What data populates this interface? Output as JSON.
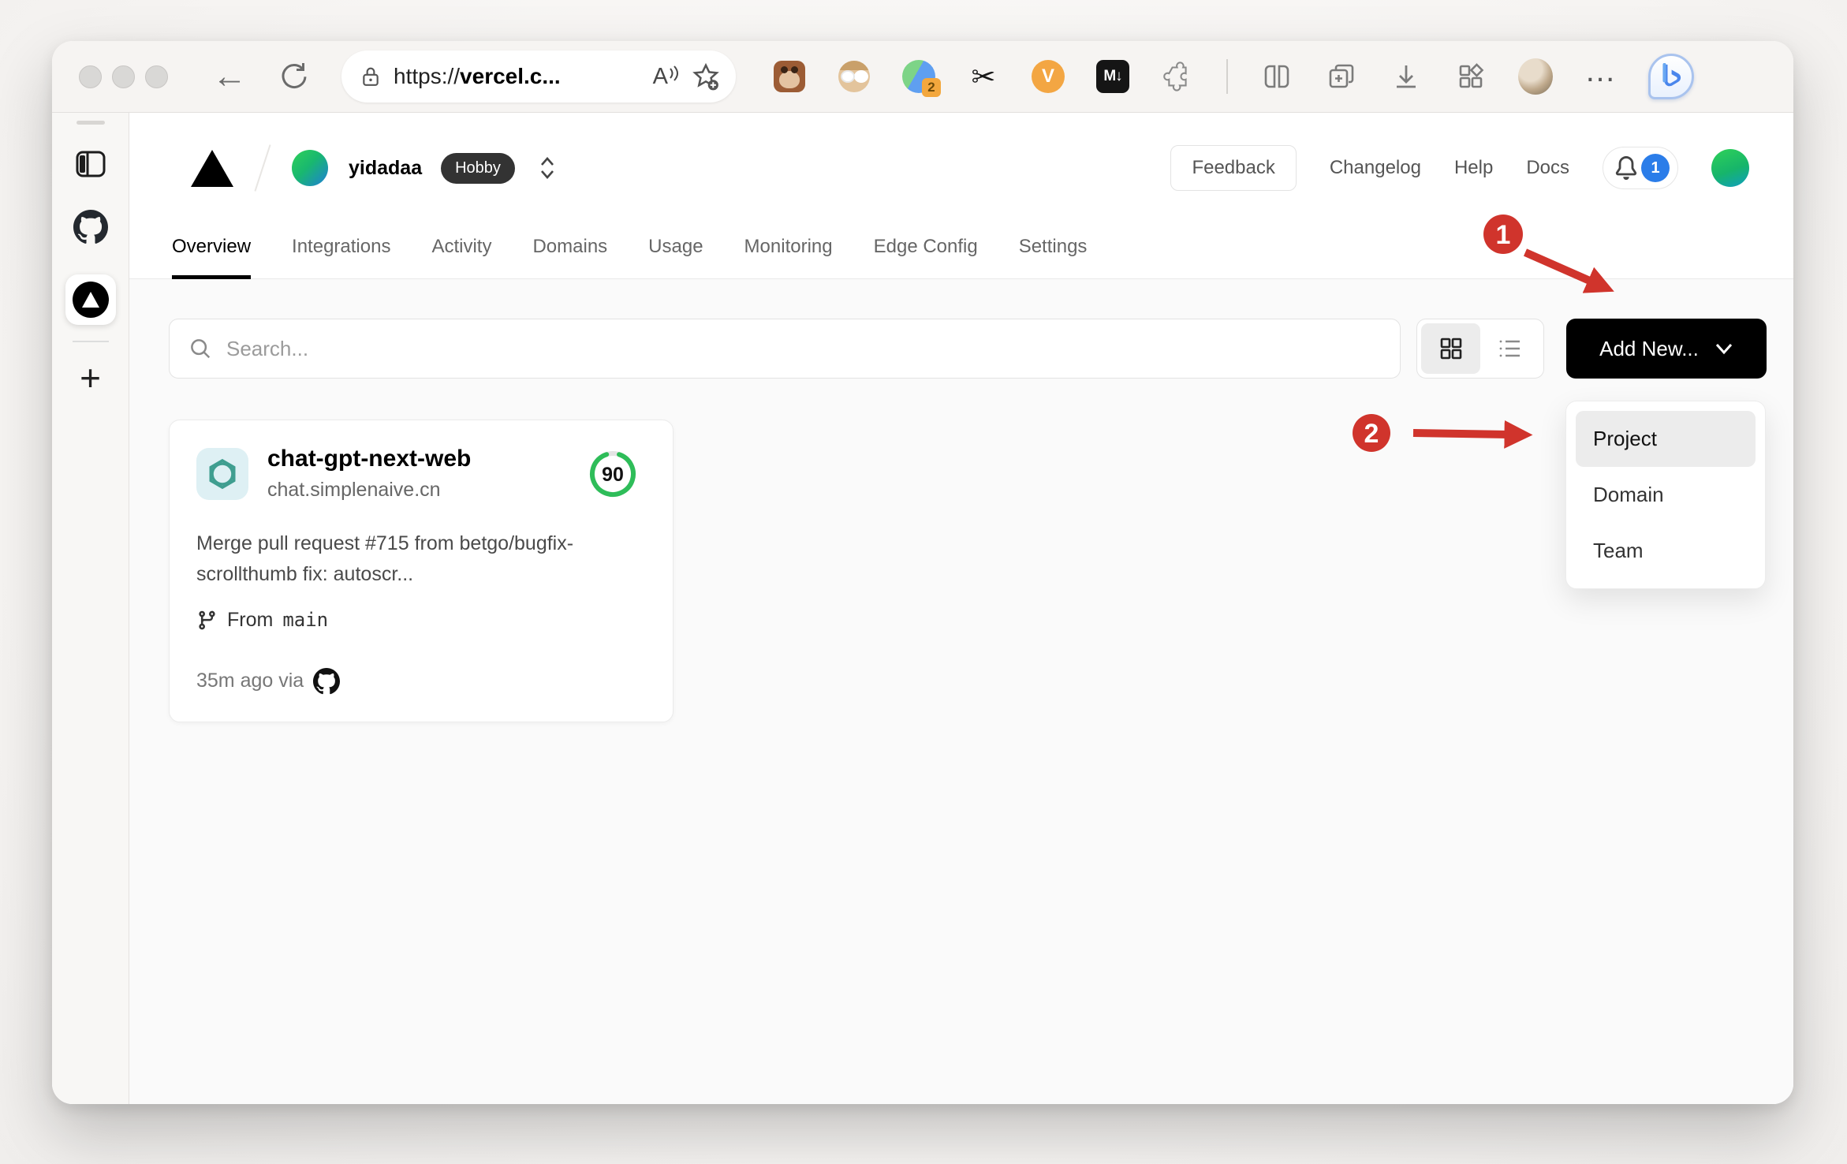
{
  "browser": {
    "url_scheme": "https://",
    "url_host": "vercel.c...",
    "reader_label": "A",
    "extensions": {
      "badge_count": "2",
      "v_label": "V",
      "md_label": "M↓",
      "ellipsis": "…"
    }
  },
  "sidebar": {
    "new_tab_label": "+"
  },
  "dashboard": {
    "team": {
      "name": "yidadaa",
      "plan": "Hobby"
    },
    "nav": {
      "feedback": "Feedback",
      "changelog": "Changelog",
      "help": "Help",
      "docs": "Docs",
      "notification_count": "1"
    },
    "tabs": [
      {
        "label": "Overview",
        "active": true
      },
      {
        "label": "Integrations",
        "active": false
      },
      {
        "label": "Activity",
        "active": false
      },
      {
        "label": "Domains",
        "active": false
      },
      {
        "label": "Usage",
        "active": false
      },
      {
        "label": "Monitoring",
        "active": false
      },
      {
        "label": "Edge Config",
        "active": false
      },
      {
        "label": "Settings",
        "active": false
      }
    ],
    "toolbar": {
      "search_placeholder": "Search...",
      "add_new": "Add New..."
    },
    "dropdown": {
      "items": [
        {
          "label": "Project",
          "highlighted": true
        },
        {
          "label": "Domain",
          "highlighted": false
        },
        {
          "label": "Team",
          "highlighted": false
        }
      ]
    },
    "project": {
      "name": "chat-gpt-next-web",
      "domain": "chat.simplenaive.cn",
      "score": "90",
      "commit": "Merge pull request #715 from betgo/bugfix-scrollthumb fix: autoscr...",
      "from_label": "From",
      "branch": "main",
      "deployed": "35m ago via"
    },
    "annotations": [
      {
        "number": "1"
      },
      {
        "number": "2"
      }
    ]
  },
  "colors": {
    "annotation_red": "#d0342c",
    "score_green": "#2ebd59",
    "notification_blue": "#2b7de9",
    "button_black": "#000000",
    "hobby_badge": "#333333"
  }
}
